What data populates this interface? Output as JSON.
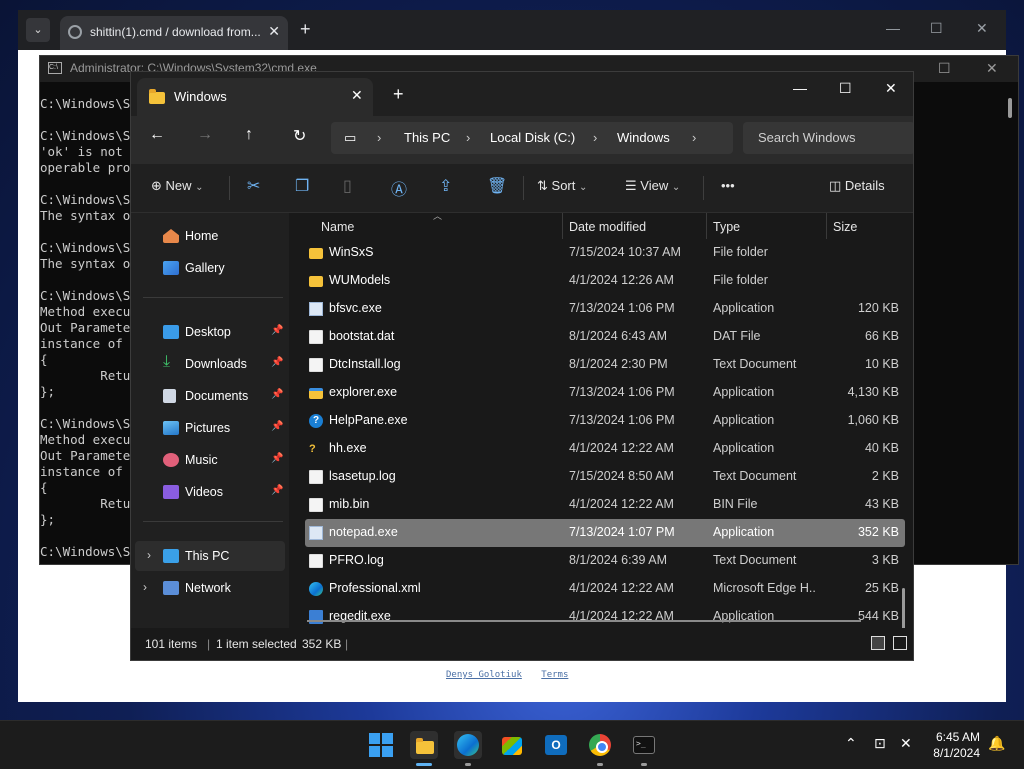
{
  "browser": {
    "tab_title": "shittin(1).cmd / download from...",
    "footer_links": [
      "Denys Golotiuk",
      "Terms"
    ]
  },
  "cmd": {
    "title": "Administrator: C:\\Windows\\System32\\cmd.exe",
    "lines": [
      "C:\\Windows\\S",
      "",
      "C:\\Windows\\S",
      "'ok' is not",
      "operable pro",
      "",
      "C:\\Windows\\S",
      "The syntax o",
      "",
      "C:\\Windows\\S",
      "The syntax o",
      "",
      "C:\\Windows\\S",
      "Method execu",
      "Out Paramete",
      "instance of",
      "{",
      "        Retu",
      "};",
      "",
      "C:\\Windows\\S",
      "Method execu",
      "Out Paramete",
      "instance of",
      "{",
      "        Retu",
      "};",
      "",
      "C:\\Windows\\S"
    ]
  },
  "explorer": {
    "tab_title": "Windows",
    "address": [
      "This PC",
      "Local Disk (C:)",
      "Windows"
    ],
    "search_placeholder": "Search Windows",
    "toolbar": {
      "new": "New",
      "sort": "Sort",
      "view": "View",
      "details": "Details"
    },
    "sidebar": {
      "top": [
        "Home",
        "Gallery"
      ],
      "pinned": [
        "Desktop",
        "Downloads",
        "Documents",
        "Pictures",
        "Music",
        "Videos"
      ],
      "bottom": [
        "This PC",
        "Network"
      ]
    },
    "columns": [
      "Name",
      "Date modified",
      "Type",
      "Size"
    ],
    "files": [
      {
        "name": "WinSxS",
        "date": "7/15/2024 10:37 AM",
        "type": "File folder",
        "size": "",
        "icon": "folder"
      },
      {
        "name": "WUModels",
        "date": "4/1/2024 12:26 AM",
        "type": "File folder",
        "size": "",
        "icon": "folder"
      },
      {
        "name": "bfsvc.exe",
        "date": "7/13/2024 1:06 PM",
        "type": "Application",
        "size": "120 KB",
        "icon": "app"
      },
      {
        "name": "bootstat.dat",
        "date": "8/1/2024 6:43 AM",
        "type": "DAT File",
        "size": "66 KB",
        "icon": "doc"
      },
      {
        "name": "DtcInstall.log",
        "date": "8/1/2024 2:30 PM",
        "type": "Text Document",
        "size": "10 KB",
        "icon": "doc"
      },
      {
        "name": "explorer.exe",
        "date": "7/13/2024 1:06 PM",
        "type": "Application",
        "size": "4,130 KB",
        "icon": "exp"
      },
      {
        "name": "HelpPane.exe",
        "date": "7/13/2024 1:06 PM",
        "type": "Application",
        "size": "1,060 KB",
        "icon": "help"
      },
      {
        "name": "hh.exe",
        "date": "4/1/2024 12:22 AM",
        "type": "Application",
        "size": "40 KB",
        "icon": "hh"
      },
      {
        "name": "lsasetup.log",
        "date": "7/15/2024 8:50 AM",
        "type": "Text Document",
        "size": "2 KB",
        "icon": "doc"
      },
      {
        "name": "mib.bin",
        "date": "4/1/2024 12:22 AM",
        "type": "BIN File",
        "size": "43 KB",
        "icon": "doc"
      },
      {
        "name": "notepad.exe",
        "date": "7/13/2024 1:07 PM",
        "type": "Application",
        "size": "352 KB",
        "icon": "app",
        "selected": true
      },
      {
        "name": "PFRO.log",
        "date": "8/1/2024 6:39 AM",
        "type": "Text Document",
        "size": "3 KB",
        "icon": "doc"
      },
      {
        "name": "Professional.xml",
        "date": "4/1/2024 12:22 AM",
        "type": "Microsoft Edge H...",
        "size": "25 KB",
        "icon": "edge"
      },
      {
        "name": "regedit.exe",
        "date": "4/1/2024 12:22 AM",
        "type": "Application",
        "size": "544 KB",
        "icon": "reg"
      }
    ],
    "status": {
      "items": "101 items",
      "selected": "1 item selected",
      "size": "352 KB"
    }
  },
  "taskbar": {
    "time": "6:45 AM",
    "date": "8/1/2024"
  }
}
